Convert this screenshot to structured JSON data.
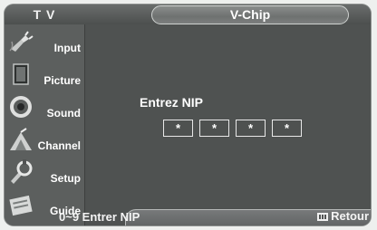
{
  "topbar": {
    "tv_label": "T V",
    "title": "V-Chip"
  },
  "sidebar": {
    "items": [
      {
        "label": "Input",
        "icon": "input-plug-icon"
      },
      {
        "label": "Picture",
        "icon": "picture-icon"
      },
      {
        "label": "Sound",
        "icon": "speaker-icon"
      },
      {
        "label": "Channel",
        "icon": "antenna-icon"
      },
      {
        "label": "Setup",
        "icon": "setup-icon"
      },
      {
        "label": "Guide",
        "icon": "program-guide-icon"
      }
    ]
  },
  "main": {
    "pin_label": "Entrez NIP",
    "pin_digits": [
      "*",
      "*",
      "*",
      "*"
    ]
  },
  "footer": {
    "hint": "0~9 Entrer NIP",
    "return_label": "Retour",
    "return_icon": "menu-icon"
  },
  "colors": {
    "panel": "#525454",
    "sidebar": "#5c5f5e",
    "text": "#ffffff"
  }
}
